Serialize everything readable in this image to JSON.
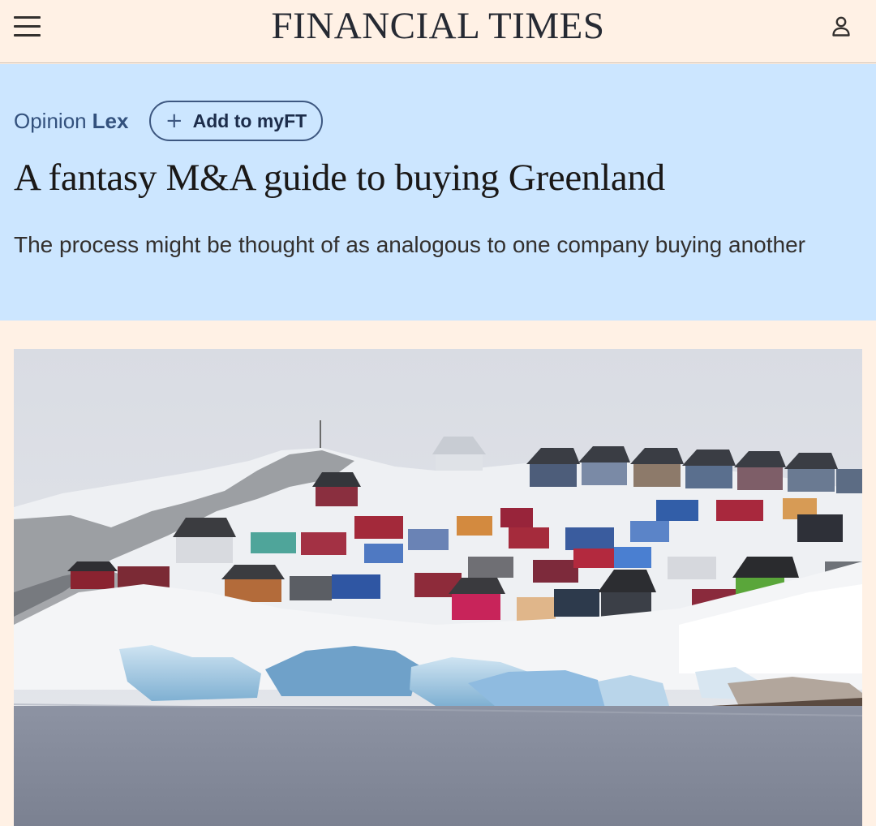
{
  "header": {
    "brand": "FINANCIAL TIMES",
    "menu_icon": "hamburger-menu-icon",
    "account_icon": "user-account-icon"
  },
  "article": {
    "category": "Opinion",
    "series": "Lex",
    "follow_plus": "+",
    "follow_label": "Add to myFT",
    "headline": "A fantasy M&A guide to buying Greenland",
    "standfirst": "The process might be thought of as analogous to one company buying another"
  },
  "image": {
    "subject": "photograph-greenland-town-icebergs"
  },
  "colors": {
    "page_background": "#fff1e5",
    "topper_background": "#cce6ff",
    "topic_link": "#33517d",
    "headline_text": "#1a1817"
  }
}
